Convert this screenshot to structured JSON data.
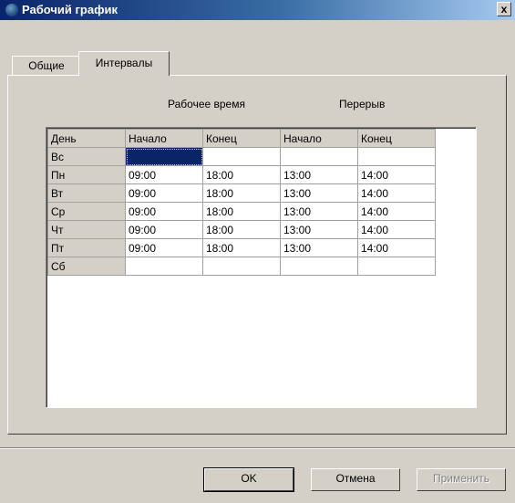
{
  "window": {
    "title": "Рабочий график",
    "close_label": "x"
  },
  "tabs": [
    {
      "label": "Общие",
      "active": false
    },
    {
      "label": "Интервалы",
      "active": true
    }
  ],
  "groups": {
    "work_time": "Рабочее время",
    "break_time": "Перерыв"
  },
  "grid": {
    "headers": [
      "День",
      "Начало",
      "Конец",
      "Начало",
      "Конец"
    ],
    "selected_cell": {
      "row": 0,
      "column": 1
    },
    "rows": [
      {
        "day": "Вс",
        "cells": [
          "",
          "",
          "",
          ""
        ]
      },
      {
        "day": "Пн",
        "cells": [
          "09:00",
          "18:00",
          "13:00",
          "14:00"
        ]
      },
      {
        "day": "Вт",
        "cells": [
          "09:00",
          "18:00",
          "13:00",
          "14:00"
        ]
      },
      {
        "day": "Ср",
        "cells": [
          "09:00",
          "18:00",
          "13:00",
          "14:00"
        ]
      },
      {
        "day": "Чт",
        "cells": [
          "09:00",
          "18:00",
          "13:00",
          "14:00"
        ]
      },
      {
        "day": "Пт",
        "cells": [
          "09:00",
          "18:00",
          "13:00",
          "14:00"
        ]
      },
      {
        "day": "Сб",
        "cells": [
          "",
          "",
          "",
          ""
        ]
      }
    ]
  },
  "buttons": {
    "ok": "OK",
    "cancel": "Отмена",
    "apply": "Применить",
    "apply_enabled": false
  },
  "colors": {
    "title_bar": "#0a246a",
    "selection": "#0a246a",
    "face": "#d4d0c8"
  }
}
